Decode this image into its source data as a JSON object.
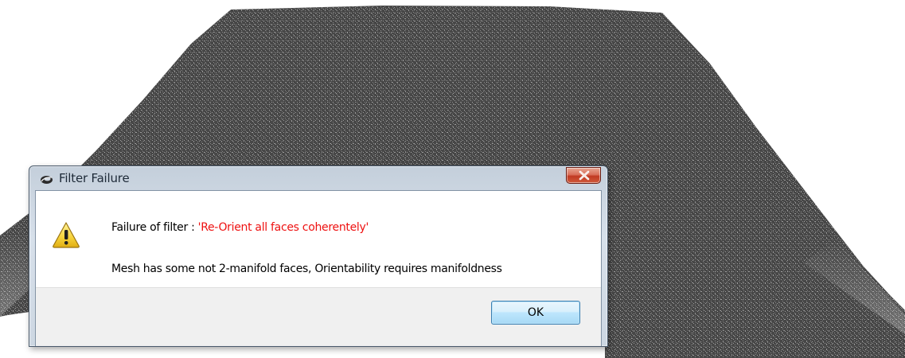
{
  "dialog": {
    "title": "Filter Failure",
    "message_prefix": "Failure of filter : ",
    "filter_name": "'Re-Orient all faces coherentely'",
    "message_detail": "Mesh has some not 2-manifold faces, Orientability requires manifoldness",
    "ok_label": "OK",
    "title_icon": "meshlab-logo-icon",
    "close_icon": "close-icon",
    "message_icon": "warning-icon"
  },
  "colors": {
    "filter_name_text": "#ee1111",
    "mesh_fill": "#4a4a4a",
    "close_button": "#c13a22"
  }
}
